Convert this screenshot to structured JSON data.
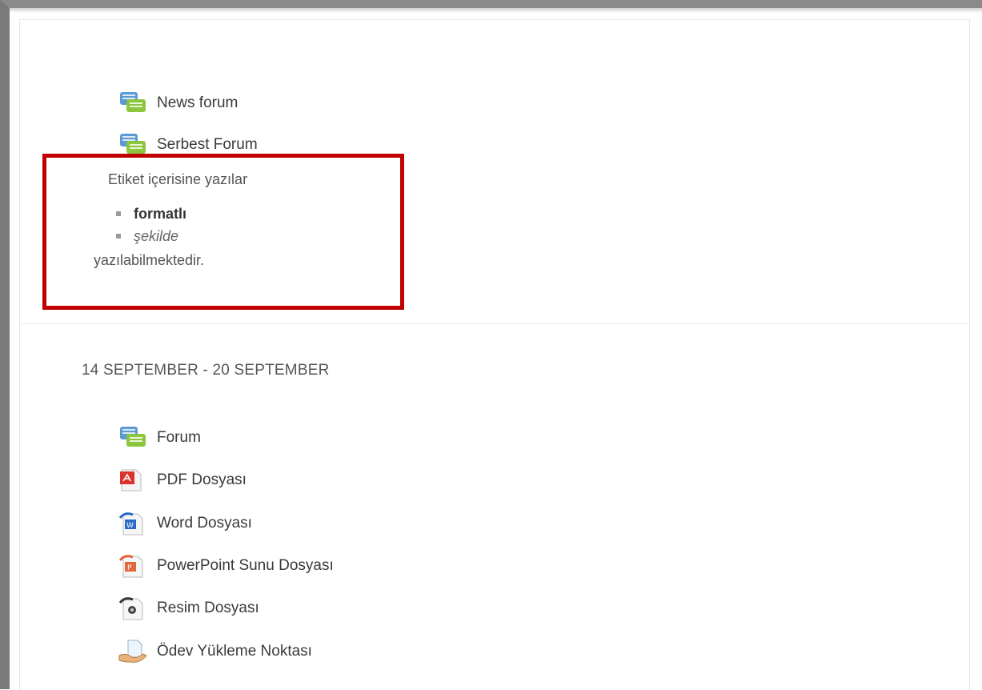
{
  "top_activities": [
    {
      "label": "News forum",
      "icon": "forum-icon"
    },
    {
      "label": "Serbest Forum",
      "icon": "forum-icon"
    }
  ],
  "label_block": {
    "intro": "Etiket içerisine yazılar",
    "items": [
      {
        "text": "formatlı",
        "style": "bold"
      },
      {
        "text": "şekilde",
        "style": "italic"
      }
    ],
    "outro": "yazılabilmektedir."
  },
  "highlight_color": "#c00000",
  "week_section": {
    "title": "14 SEPTEMBER - 20 SEPTEMBER",
    "activities": [
      {
        "label": "Forum",
        "icon": "forum-icon"
      },
      {
        "label": "PDF Dosyası",
        "icon": "pdf-icon"
      },
      {
        "label": "Word Dosyası",
        "icon": "word-icon"
      },
      {
        "label": "PowerPoint Sunu Dosyası",
        "icon": "powerpoint-icon"
      },
      {
        "label": "Resim Dosyası",
        "icon": "image-icon"
      },
      {
        "label": "Ödev Yükleme Noktası",
        "icon": "assignment-icon"
      }
    ]
  }
}
